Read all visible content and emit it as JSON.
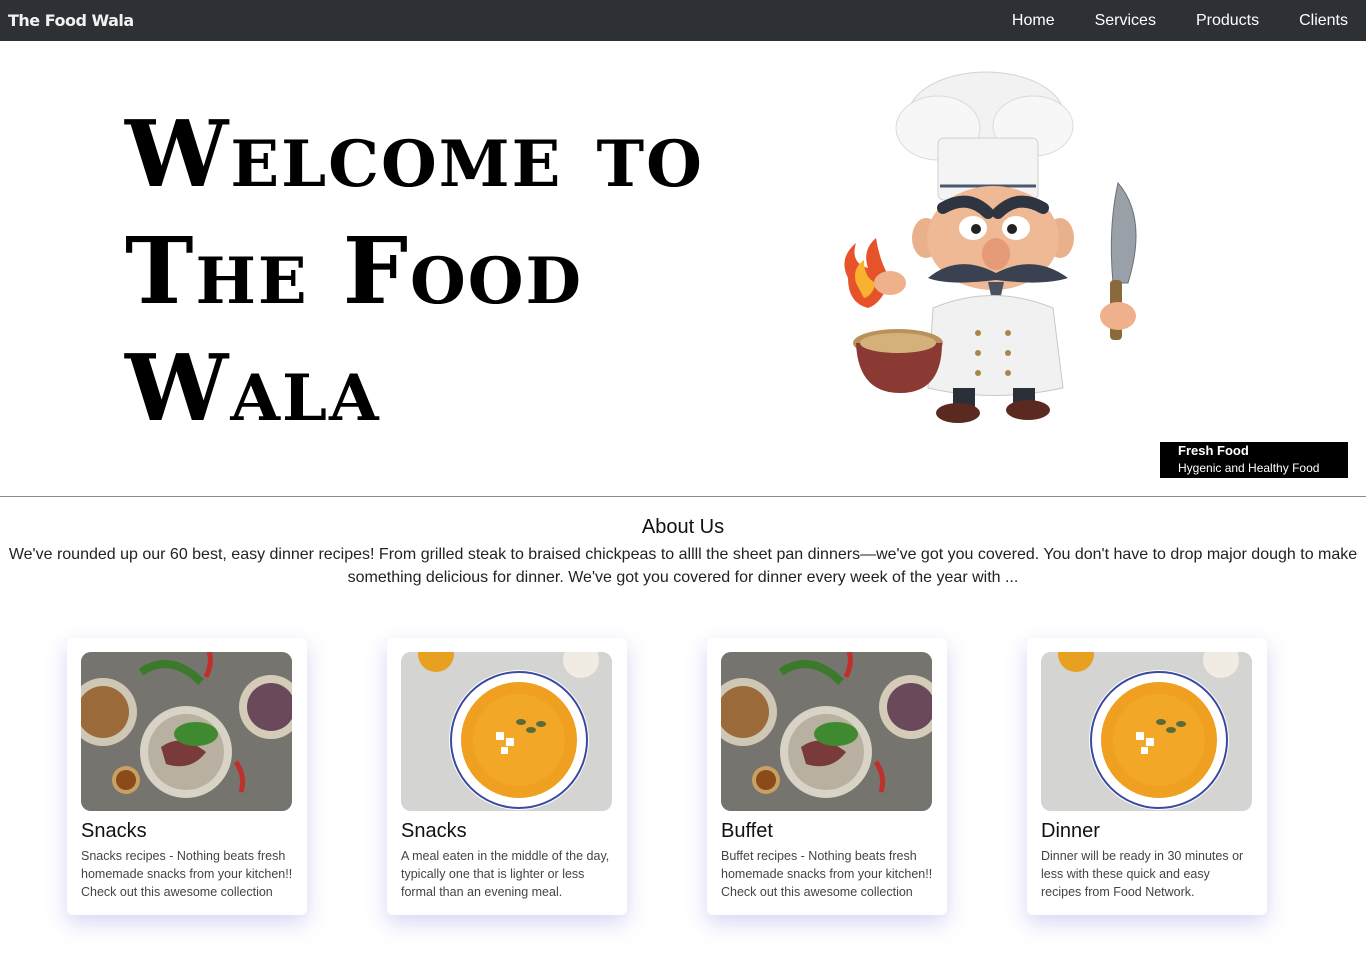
{
  "navbar": {
    "brand": "The Food Wala",
    "links": [
      "Home",
      "Services",
      "Products",
      "Clients"
    ]
  },
  "hero": {
    "title_lines": [
      "Welcome to",
      "The Food",
      "Wala"
    ],
    "tag_title": "Fresh Food",
    "tag_subtitle": "Hygenic and Healthy Food"
  },
  "about": {
    "heading": "About Us",
    "text": "We've rounded up our 60 best, easy dinner recipes! From grilled steak to braised chickpeas to allll the sheet pan dinners—we've got you covered. You don't have to drop major dough to make something delicious for dinner. We've got you covered for dinner every week of the year with ..."
  },
  "cards": [
    {
      "title": "Snacks",
      "text": "Snacks recipes - Nothing beats fresh homemade snacks from your kitchen!! Check out this awesome collection",
      "image": "platter-image"
    },
    {
      "title": "Snacks",
      "text": "A meal eaten in the middle of the day, typically one that is lighter or less formal than an evening meal.",
      "image": "soup-image"
    },
    {
      "title": "Buffet",
      "text": "Buffet recipes - Nothing beats fresh homemade snacks from your kitchen!! Check out this awesome collection",
      "image": "platter-image"
    },
    {
      "title": "Dinner",
      "text": "Dinner will be ready in 30 minutes or less with these quick and easy recipes from Food Network.",
      "image": "soup-image"
    }
  ]
}
